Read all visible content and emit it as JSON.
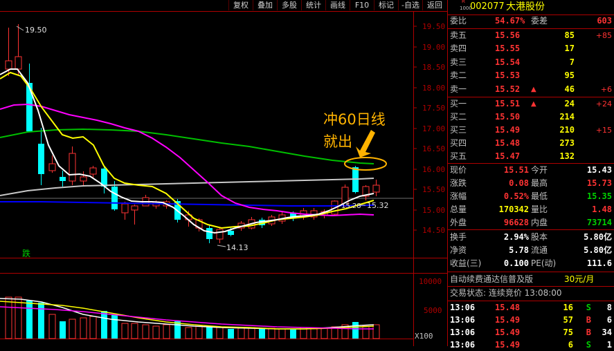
{
  "toolbar": {
    "items": [
      "复权",
      "叠加",
      "多股",
      "统计",
      "画线",
      "F10",
      "标记",
      "-自选",
      "返回"
    ]
  },
  "chart": {
    "price_labels": [
      "19.50",
      "19.00",
      "18.50",
      "18.00",
      "17.50",
      "17.00",
      "16.50",
      "16.00",
      "15.50",
      "15.00",
      "14.50"
    ],
    "volume_labels": [
      "10000",
      "5000"
    ],
    "volume_unit": "X100",
    "high_marker": "19.50",
    "low_marker": "14.13",
    "ma_marker": "15.32",
    "ma_marker_left": "15.28",
    "annotation_line1": "冲60日线",
    "annotation_line2": "就出",
    "flag_label": "跌"
  },
  "stock": {
    "badge_top": "R",
    "badge_bottom": "1000",
    "code": "002077",
    "name": "大港股份"
  },
  "ratio": {
    "label1": "委比",
    "value1": "54.67%",
    "label2": "委差",
    "value2": "603"
  },
  "asks": [
    {
      "label": "卖五",
      "price": "15.56",
      "vol": "85",
      "chg": "+85",
      "arrow": ""
    },
    {
      "label": "卖四",
      "price": "15.55",
      "vol": "17",
      "chg": "",
      "arrow": ""
    },
    {
      "label": "卖三",
      "price": "15.54",
      "vol": "7",
      "chg": "",
      "arrow": ""
    },
    {
      "label": "卖二",
      "price": "15.53",
      "vol": "95",
      "chg": "",
      "arrow": ""
    },
    {
      "label": "卖一",
      "price": "15.52",
      "vol": "46",
      "chg": "+6",
      "arrow": "▲"
    }
  ],
  "bids": [
    {
      "label": "买一",
      "price": "15.51",
      "vol": "24",
      "chg": "+24",
      "arrow": "▲"
    },
    {
      "label": "买二",
      "price": "15.50",
      "vol": "214",
      "chg": "",
      "arrow": ""
    },
    {
      "label": "买三",
      "price": "15.49",
      "vol": "210",
      "chg": "+15",
      "arrow": ""
    },
    {
      "label": "买四",
      "price": "15.48",
      "vol": "273",
      "chg": "",
      "arrow": ""
    },
    {
      "label": "买五",
      "price": "15.47",
      "vol": "132",
      "chg": "",
      "arrow": ""
    }
  ],
  "quote": [
    {
      "l1": "现价",
      "v1": "15.51",
      "c1": "red",
      "l2": "今开",
      "v2": "15.43",
      "c2": "wht"
    },
    {
      "l1": "涨跌",
      "v1": "0.08",
      "c1": "red",
      "l2": "最高",
      "v2": "15.73",
      "c2": "red"
    },
    {
      "l1": "涨幅",
      "v1": "0.52%",
      "c1": "red",
      "l2": "最低",
      "v2": "15.35",
      "c2": "grn"
    },
    {
      "l1": "总量",
      "v1": "170342",
      "c1": "yel",
      "l2": "量比",
      "v2": "1.48",
      "c2": "red"
    },
    {
      "l1": "外盘",
      "v1": "96628",
      "c1": "red",
      "l2": "内盘",
      "v2": "73714",
      "c2": "grn"
    }
  ],
  "stats": [
    {
      "l1": "换手",
      "v1": "2.94%",
      "l2": "股本",
      "v2": "5.80亿"
    },
    {
      "l1": "净资",
      "v1": "5.78",
      "l2": "流通",
      "v2": "5.80亿"
    },
    {
      "l1": "收益(三)",
      "v1": "0.100",
      "l2": "PE(动)",
      "v2": "111.6"
    }
  ],
  "ad": {
    "text": "自动续费通达信普及版",
    "price": "30元/月"
  },
  "trade_status": {
    "text": "交易状态: 连续竞价 13:08:00"
  },
  "ticks": [
    {
      "time": "13:06",
      "price": "15.48",
      "vol": "16",
      "side": "S",
      "n": "8"
    },
    {
      "time": "13:06",
      "price": "15.49",
      "vol": "57",
      "side": "B",
      "n": "6"
    },
    {
      "time": "13:06",
      "price": "15.49",
      "vol": "75",
      "side": "B",
      "n": "34"
    },
    {
      "time": "13:06",
      "price": "15.49",
      "vol": "6",
      "side": "S",
      "n": "1"
    }
  ],
  "colors": {
    "up": "#ff3333",
    "down": "#00ffff",
    "ma5": "#ffffff",
    "ma10": "#ffff00",
    "ma20": "#ff00ff",
    "ma60": "#00c000",
    "annotation": "#ffb300"
  }
}
